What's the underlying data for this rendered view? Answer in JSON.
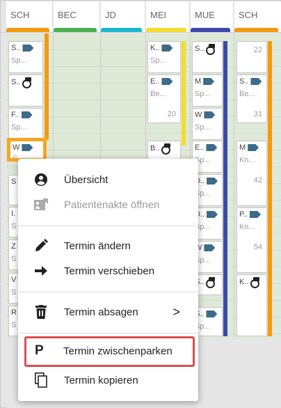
{
  "columns": [
    {
      "label": "SCH",
      "color": "#f59a0c"
    },
    {
      "label": "BEC",
      "color": "#4caf50"
    },
    {
      "label": "JD",
      "color": "#17b6d0"
    },
    {
      "label": "MEI",
      "color": "#f5dd2a"
    },
    {
      "label": "MUE",
      "color": "#3b4aa8"
    },
    {
      "label": "SCH",
      "color": "#f59a0c"
    }
  ],
  "cards": {
    "c1": {
      "l1": "S..",
      "l2": "Sp..."
    },
    "c2": {
      "l1": "S.."
    },
    "c3": {
      "l1": "F..",
      "l2": "Sp..."
    },
    "c4": {
      "l1": "W",
      "l2": "S"
    },
    "c5": {
      "l1": "S"
    },
    "c6": {
      "l1": "I.",
      "l2": "S"
    },
    "c7": {
      "l1": "Z",
      "l2": "S"
    },
    "c8": {
      "l1": "V",
      "l2": "S"
    },
    "c9": {
      "l1": "R",
      "l2": "S"
    },
    "m1": {
      "l1": "K..",
      "l2": "Sp..."
    },
    "m2": {
      "l1": "E..",
      "l2": "Be...",
      "num": "20"
    },
    "m3": {
      "l1": "B.."
    },
    "u1": {
      "l1": "S.."
    },
    "u2": {
      "l1": "M",
      "l2": "Sp..."
    },
    "u3": {
      "l1": "W",
      "l2": "Sp..."
    },
    "u4": {
      "l1": "E..",
      "l2": "Sp..."
    },
    "u5": {
      "l1": "D..",
      "l2": "Sp..."
    },
    "u6": {
      "l1": "D..",
      "l2": "Sp..."
    },
    "u7": {
      "l1": "W",
      "l2": "Sp..."
    },
    "u8": {
      "l1": "S.."
    },
    "u9": {
      "l1": "S..",
      "l2": "Sp..."
    },
    "s1": {
      "num": "22"
    },
    "s2": {
      "l1": "S..",
      "l2": "Be...",
      "num": "31"
    },
    "s3": {
      "l1": "M",
      "l2": "Kn...",
      "num": "42"
    },
    "s4": {
      "l1": "P..",
      "l2": "Kn...",
      "num": "54"
    },
    "s5": {
      "l1": "K.."
    }
  },
  "menu": {
    "overview": "Übersicht",
    "open_record": "Patientenakte öffnen",
    "edit": "Termin ändern",
    "move": "Termin verschieben",
    "cancel": "Termin absagen",
    "cancel_chevron": ">",
    "park": "Termin zwischenparken",
    "copy": "Termin kopieren",
    "park_icon": "P"
  }
}
